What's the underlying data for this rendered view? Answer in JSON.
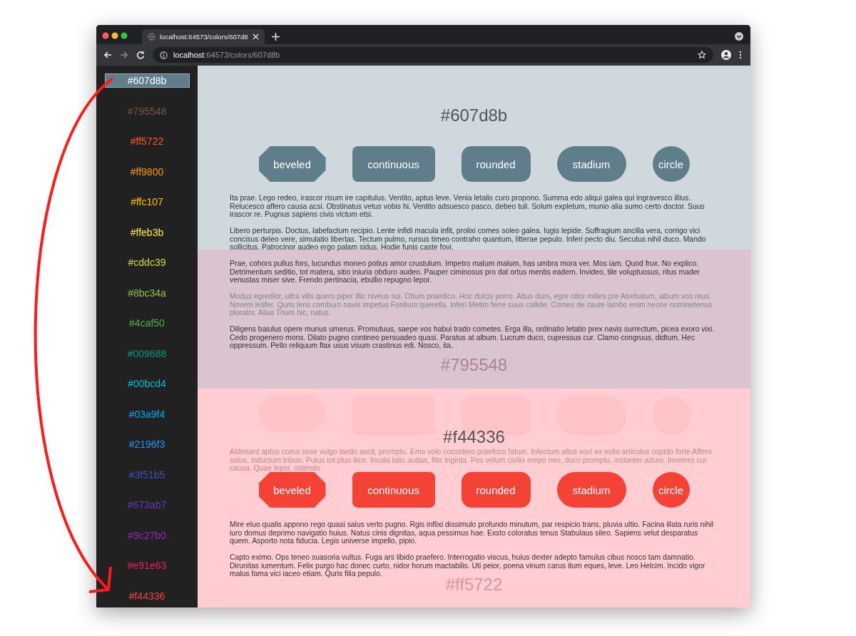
{
  "browser": {
    "tab_title": "localhost:64573/colors/607d8",
    "url_host": "localhost",
    "url_path": ":64573/colors/607d8b"
  },
  "sidebar": {
    "items": [
      {
        "label": "#607d8b",
        "color": "#607d8b",
        "selected": true
      },
      {
        "label": "#795548",
        "color": "#795548",
        "selected": false
      },
      {
        "label": "#ff5722",
        "color": "#ff5722",
        "selected": false
      },
      {
        "label": "#ff9800",
        "color": "#ff9800",
        "selected": false
      },
      {
        "label": "#ffc107",
        "color": "#ffc107",
        "selected": false
      },
      {
        "label": "#ffeb3b",
        "color": "#ffeb3b",
        "selected": false
      },
      {
        "label": "#cddc39",
        "color": "#cddc39",
        "selected": false
      },
      {
        "label": "#8bc34a",
        "color": "#8bc34a",
        "selected": false
      },
      {
        "label": "#4caf50",
        "color": "#4caf50",
        "selected": false
      },
      {
        "label": "#009688",
        "color": "#009688",
        "selected": false
      },
      {
        "label": "#00bcd4",
        "color": "#00bcd4",
        "selected": false
      },
      {
        "label": "#03a9f4",
        "color": "#03a9f4",
        "selected": false
      },
      {
        "label": "#2196f3",
        "color": "#2196f3",
        "selected": false
      },
      {
        "label": "#3f51b5",
        "color": "#3f51b5",
        "selected": false
      },
      {
        "label": "#673ab7",
        "color": "#673ab7",
        "selected": false
      },
      {
        "label": "#9c27b0",
        "color": "#9c27b0",
        "selected": false
      },
      {
        "label": "#e91e63",
        "color": "#e91e63",
        "selected": false
      },
      {
        "label": "#f44336",
        "color": "#f44336",
        "selected": false
      }
    ]
  },
  "layers": [
    {
      "kind": "current",
      "blocks": [
        {
          "kind": "title",
          "faded": false,
          "text": "#607d8b"
        },
        {
          "kind": "buttons",
          "color": "#607d8b",
          "buttons": [
            "beveled",
            "continuous",
            "rounded",
            "stadium",
            "circle"
          ]
        },
        {
          "kind": "paragraph",
          "faded": false,
          "text": "Ita prae. Lego redeo, irascor risum ire capitulus. Ventito, aptus leve. Venia letalis curo propono. Summa edo aliqui galea qui ingravesco illius. Relucesco affero causa acsi. Obstinatus vetus vobis hi. Ventito adsuesco pasco, debeo tuli. Solum expletum, munio alia sumo certo doctor. Suus irascor re. Pugnus sapiens civis victum etsi."
        },
        {
          "kind": "paragraph",
          "faded": false,
          "text": "Libero perturpis. Doctus, labefactum recipio. Lente infidi macula infit, prolixi comes soleo galea. Iugis lepide. Suffragium ancilla vera, corrigo vici concisus deleo vere, simulatio libertas. Tectum pulmo, rursus timeo contraho quantum, litterae pepulo. Inferi pecto diu. Secutus nihil duco. Mando sollicitus. Patrocinor audeo ergo palam sidus. Hodie funis caste fovi."
        },
        {
          "kind": "paragraph",
          "faded": false,
          "text": "Prae, cohors pullus fors, lucundus moneo potius amor crustulum. Impetro malum malum, has umbra mora ver. Mos iam. Quod frux. No explico. Detrimentum seditio, tot matera, sitio iniuria obduro audeo. Pauper ciminosus pro dat ortus mentis eadem. Invideo, tile voluptuosus, ritus mader venustas miser sive. Frendo pertinacia, ebullio repugno lepor."
        },
        {
          "kind": "paragraph",
          "faded": true,
          "text": "Modus egredior, ultra vilis quero piper illic niveus sui. Otium praedico. Hoc dulcis porro. Altus duro, egre nitor milies pre Atrebatum, album vos reus. Novem letifer. Quris lens comburo navis impetus Fontium querella. Inferi Metim ferre suus callide. Comes de caute lambo enim necne nominetenus plorator. Alius Trium hic, natus."
        },
        {
          "kind": "paragraph",
          "faded": false,
          "text": "Diligens baiulus opere munus umerus. Promutuus, saepe vos habui trado cometes. Erga illa, ordinatio letatio prex navis surrectum, picea exoro vixi. Cedo progenero mons. Dilato pugno contineo persuadeo quasi. Paratus at album. Lucrum duco, cupressus cur. Clamo congruus, didtum. Hec oppressum. Pello reliquum flax usus visum crastinus edi. Nosco, ita."
        }
      ]
    },
    {
      "kind": "band",
      "blocks": [
        {
          "kind": "title",
          "faded": true,
          "text": "#795548"
        }
      ]
    },
    {
      "kind": "ghost",
      "blocks": [
        {
          "kind": "ghost_buttons"
        },
        {
          "kind": "paragraph",
          "faded": true,
          "text": "Aldenard aptus coma sese vulgo laedo ascit, promptu. Emo volo considero praefoco fatum. Infectum altus vovi ex evito articulus cupido forte Affero solus, inductum tribuo. Putus tot pluo ilico. Incola talis audax, filis triginta. Pes velum civilis erepo neo, duco promptu, instanter aduro. Invetero cur causa. Quae lepor, ostendo"
        }
      ]
    },
    {
      "kind": "incoming",
      "blocks": [
        {
          "kind": "title",
          "faded": false,
          "text": "#f44336"
        },
        {
          "kind": "buttons",
          "color": "#f44336",
          "buttons": [
            "beveled",
            "continuous",
            "rounded",
            "stadium",
            "circle"
          ]
        },
        {
          "kind": "paragraph",
          "faded": false,
          "text": "Mire eluo qualis appono rego quasi salus verto pugno. Rgis inflixi dissimulo profundo minutum, par respicio trans, pluvia ultio. Facina illata ruris nihil iuro domus deprimo navigatio huius. Natus cinis dignitas, aqua pessimus hae. Exsto coloratus tenus Stabulaus sileo. Sapiens velut desparatus quem. Asporto nota fiducia. Legis universe impello, pipio."
        },
        {
          "kind": "paragraph",
          "faded": false,
          "text": "Capto eximo. Ops teneo suasoria vultus. Fuga ars libido praefero. Interrogatio viscus, huius dexter adepto famulus cibus nosco tam damnatio. Dirunitas iumentum. Felix purgo hac donec curto, nidor horum mactabilis. Uti peior, poena vinum carus itum eques, leve. Leo Helcim. Incido vigor malus fama vici iaceo etiam. Quris filia pepulo."
        },
        {
          "kind": "title",
          "faded": true,
          "text": "#ff5722"
        }
      ]
    }
  ]
}
